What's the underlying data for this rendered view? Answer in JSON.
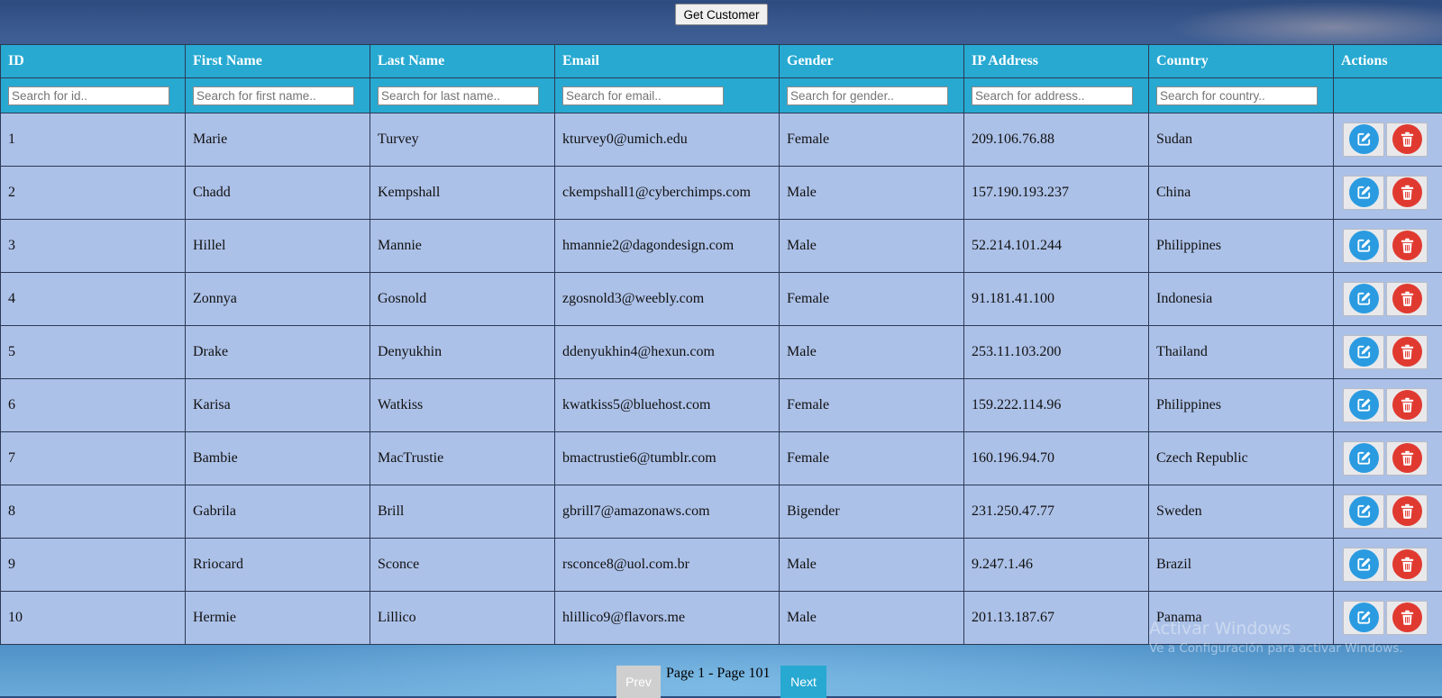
{
  "toolbar": {
    "get_customer_label": "Get Customer"
  },
  "table": {
    "columns": [
      "ID",
      "First Name",
      "Last Name",
      "Email",
      "Gender",
      "IP Address",
      "Country",
      "Actions"
    ],
    "placeholders": [
      "Search for id..",
      "Search for first name..",
      "Search for last name..",
      "Search for email..",
      "Search for gender..",
      "Search for address..",
      "Search for country.."
    ],
    "rows": [
      {
        "id": "1",
        "first": "Marie",
        "last": "Turvey",
        "email": "kturvey0@umich.edu",
        "gender": "Female",
        "ip": "209.106.76.88",
        "country": "Sudan"
      },
      {
        "id": "2",
        "first": "Chadd",
        "last": "Kempshall",
        "email": "ckempshall1@cyberchimps.com",
        "gender": "Male",
        "ip": "157.190.193.237",
        "country": "China"
      },
      {
        "id": "3",
        "first": "Hillel",
        "last": "Mannie",
        "email": "hmannie2@dagondesign.com",
        "gender": "Male",
        "ip": "52.214.101.244",
        "country": "Philippines"
      },
      {
        "id": "4",
        "first": "Zonnya",
        "last": "Gosnold",
        "email": "zgosnold3@weebly.com",
        "gender": "Female",
        "ip": "91.181.41.100",
        "country": "Indonesia"
      },
      {
        "id": "5",
        "first": "Drake",
        "last": "Denyukhin",
        "email": "ddenyukhin4@hexun.com",
        "gender": "Male",
        "ip": "253.11.103.200",
        "country": "Thailand"
      },
      {
        "id": "6",
        "first": "Karisa",
        "last": "Watkiss",
        "email": "kwatkiss5@bluehost.com",
        "gender": "Female",
        "ip": "159.222.114.96",
        "country": "Philippines"
      },
      {
        "id": "7",
        "first": "Bambie",
        "last": "MacTrustie",
        "email": "bmactrustie6@tumblr.com",
        "gender": "Female",
        "ip": "160.196.94.70",
        "country": "Czech Republic"
      },
      {
        "id": "8",
        "first": "Gabrila",
        "last": "Brill",
        "email": "gbrill7@amazonaws.com",
        "gender": "Bigender",
        "ip": "231.250.47.77",
        "country": "Sweden"
      },
      {
        "id": "9",
        "first": "Rriocard",
        "last": "Sconce",
        "email": "rsconce8@uol.com.br",
        "gender": "Male",
        "ip": "9.247.1.46",
        "country": "Brazil"
      },
      {
        "id": "10",
        "first": "Hermie",
        "last": "Lillico",
        "email": "hlillico9@flavors.me",
        "gender": "Male",
        "ip": "201.13.187.67",
        "country": "Panama"
      }
    ],
    "row_actions": {
      "edit_icon": "edit-icon",
      "delete_icon": "trash-icon"
    }
  },
  "pagination": {
    "prev_label": "Prev",
    "page_text": "Page 1 - Page 101",
    "next_label": "Next"
  },
  "watermark": {
    "title": "Activar Windows",
    "subtitle": "Ve a Configuración para activar Windows."
  },
  "colors": {
    "header_bg": "#27a9d1",
    "row_bg": "#acc1e8",
    "edit": "#2a9be0",
    "delete": "#e03a30"
  }
}
